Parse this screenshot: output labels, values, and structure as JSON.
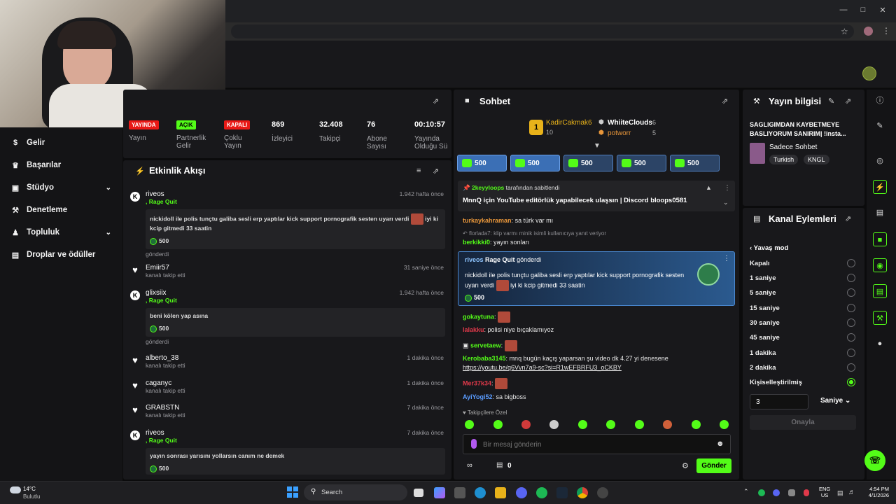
{
  "sidebar": {
    "items": [
      {
        "label": "Gelir",
        "icon": "dollar-icon"
      },
      {
        "label": "Başarılar",
        "icon": "trophy-icon"
      },
      {
        "label": "Stüdyo",
        "icon": "studio-icon"
      },
      {
        "label": "Denetleme",
        "icon": "sword-icon"
      },
      {
        "label": "Topluluk",
        "icon": "people-icon"
      },
      {
        "label": "Droplar ve ödüller",
        "icon": "gift-icon"
      }
    ]
  },
  "stats": [
    {
      "badge": "YAYINDA",
      "label": "Yayın"
    },
    {
      "badge": "AÇIK",
      "label": "Partnerlik Gelir"
    },
    {
      "badge": "KAPALI",
      "label": "Çoklu Yayın"
    },
    {
      "value": "869",
      "label": "İzleyici"
    },
    {
      "value": "32.408",
      "label": "Takipçi"
    },
    {
      "value": "76",
      "label": "Abone Sayısı"
    },
    {
      "value": "00:10:57",
      "label": "Yayında Olduğu Sü"
    }
  ],
  "activity": {
    "title": "Etkinlik Akışı",
    "events": [
      {
        "name": "riveos",
        "sub": ", Rage Quit",
        "time": "1.942 hafta önce",
        "msg": "nickidoll ile polis tunçtu galiba sesli erp yaptılar kick support pornografik sesten uyarı verdi",
        "msg2": "iyi ki kcip gitmedi 33 saatin",
        "amount": "500",
        "foot": "gönderdi"
      },
      {
        "name": "Emiir57",
        "sub": "kanalı takip etti",
        "time": "31 saniye önce"
      },
      {
        "name": "glixsiix",
        "sub": ", Rage Quit",
        "time": "1.942 hafta önce",
        "msg": "beni kölen yap asına",
        "amount": "500",
        "foot": "gönderdi"
      },
      {
        "name": "alberto_38",
        "sub": "kanalı takip etti",
        "time": "1 dakika önce"
      },
      {
        "name": "caganyc",
        "sub": "kanalı takip etti",
        "time": "1 dakika önce"
      },
      {
        "name": "GRABSTN",
        "sub": "kanalı takip etti",
        "time": "7 dakika önce"
      },
      {
        "name": "riveos",
        "sub": ", Rage Quit",
        "time": "7 dakika önce",
        "msg": "yayın sonrası yarısını yollarsın canım ne demek",
        "amount": "500"
      }
    ]
  },
  "chat": {
    "title": "Sohbet",
    "leaders": [
      {
        "name": "KadirCakmak6",
        "count": "10"
      },
      {
        "name": "WhiiteClouds",
        "count": "6"
      },
      {
        "name": "potworr",
        "count": "5"
      }
    ],
    "gifts": [
      "500",
      "500",
      "500",
      "500",
      "500"
    ],
    "pinned_by": "2keyyloops",
    "pinned_suffix": "tarafından sabitlendi",
    "pinned_text": "MnnQ için YouTube editörlük yapabilecek ulaşsın | Discord bloops0581",
    "messages": [
      {
        "user": "turkaykahraman",
        "text": "sa türk var mı"
      },
      {
        "reply": "florlada7: klip varmı minik isimli kullanıcıya yanıt veriyor"
      },
      {
        "user": "berkikki0",
        "text": "yayın sonları"
      },
      {
        "user": "gokaytuna",
        "text": ""
      },
      {
        "user": "lalakku",
        "text": "polisi niye bıçaklamıyoz"
      },
      {
        "user": "servetaew",
        "text": ""
      },
      {
        "user": "Kerobaba3145",
        "text": "mnq bugün kaçış yaparsan şu video dk 4.27 yi denesene"
      },
      {
        "link": "https://youtu.be/q6Vvn7a9-sc?si=R1wEFBRFU3_oCKBY"
      },
      {
        "user": "Mer37k34",
        "text": ""
      },
      {
        "user": "AyiYogi52",
        "text": "sa bigboss"
      }
    ],
    "highlight": {
      "user": "riveos",
      "rq": "Rage Quit",
      "verb": "gönderdi",
      "text": "nickidoll ile polis tunçtu galiba sesli erp yaptılar kick support pornografik sesten uyarı verdi",
      "text2": "iyi ki kcip gitmedi 33 saatin",
      "amount": "500"
    },
    "followers_only": "Takipçilere Özel",
    "placeholder": "Bir mesaj gönderin",
    "send": "Gönder",
    "points": "0"
  },
  "stream_info": {
    "title": "Yayın bilgisi",
    "stream_title": "SAGLIGIMDAN KAYBETMEYE BASLIYORUM SANIRIM| !insta...",
    "category": "Sadece Sohbet",
    "tags": [
      "Turkish",
      "KNGL"
    ]
  },
  "channel_actions": {
    "title": "Kanal Eylemleri",
    "mode": "Yavaş mod",
    "options": [
      "Kapalı",
      "1 saniye",
      "5 saniye",
      "15 saniye",
      "30 saniye",
      "45 saniye",
      "1 dakika",
      "2 dakika",
      "Kişiselleştirilmiş"
    ],
    "selected": "Kişiselleştirilmiş",
    "custom_value": "3",
    "unit": "Saniye",
    "confirm": "Onayla"
  },
  "taskbar": {
    "weather_temp": "14°C",
    "weather_desc": "Bulutlu",
    "search": "Search",
    "lang": "ENG",
    "region": "US",
    "time": "4:54 PM",
    "date": "4/1/2026"
  },
  "colors": {
    "accent": "#53fc18",
    "panel": "#18181b",
    "gift": "#3b6fb5",
    "live": "#e91916"
  }
}
